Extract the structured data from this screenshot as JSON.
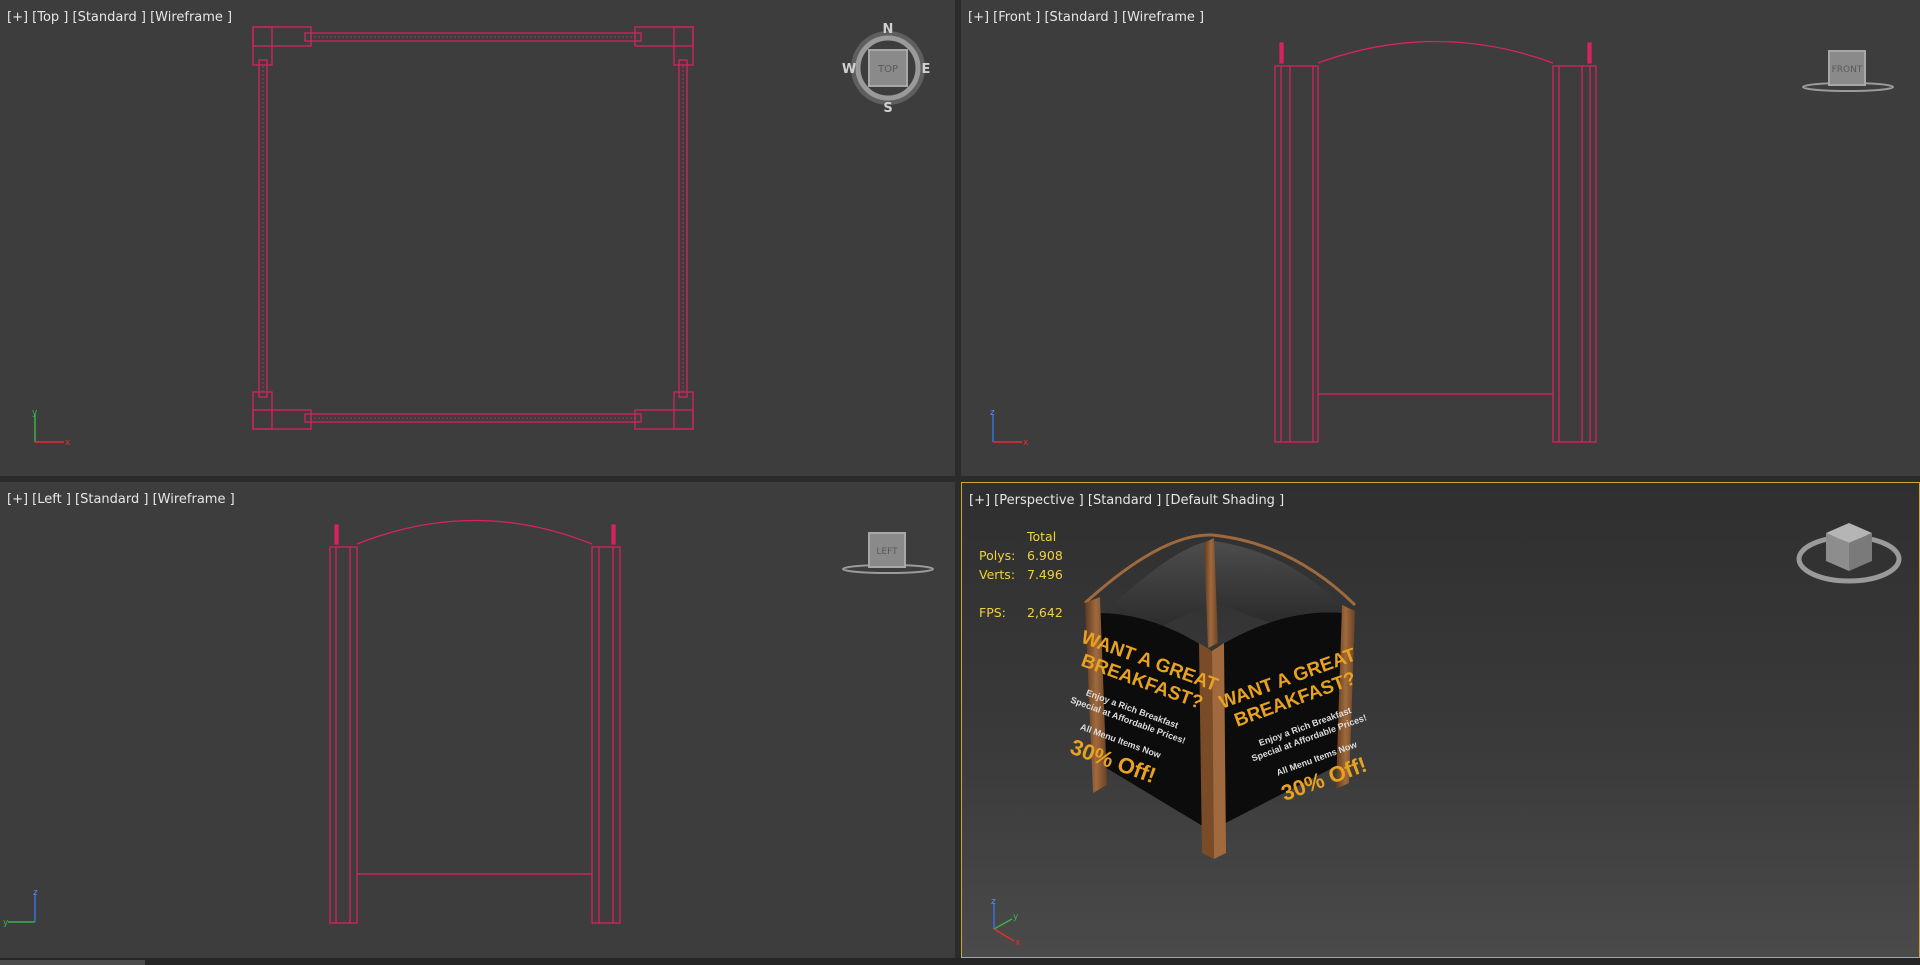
{
  "viewports": {
    "top": {
      "label": "[+] [Top ] [Standard ] [Wireframe ]",
      "cube_label": "TOP",
      "compass": {
        "n": "N",
        "s": "S",
        "e": "E",
        "w": "W"
      },
      "axes": {
        "a": "y",
        "b": "x"
      }
    },
    "front": {
      "label": "[+] [Front ] [Standard ] [Wireframe ]",
      "cube_label": "FRONT",
      "axes": {
        "a": "z",
        "b": "x"
      }
    },
    "left": {
      "label": "[+] [Left ] [Standard ] [Wireframe ]",
      "cube_label": "LEFT",
      "axes": {
        "a": "z",
        "b": "y"
      }
    },
    "perspective": {
      "label": "[+] [Perspective ] [Standard ] [Default Shading ]",
      "active": true,
      "stats": {
        "header": "Total",
        "polys_label": "Polys:",
        "polys": "6.908",
        "verts_label": "Verts:",
        "verts": "7.496",
        "fps_label": "FPS:",
        "fps": "2,642"
      },
      "sign_text": {
        "headline1": "WANT A GREAT",
        "headline2": "BREAKFAST?",
        "line1": "Enjoy a Rich Breakfast",
        "line2": "Special at Affordable Prices!",
        "line3": "All Menu Items Now",
        "discount": "30% Off!"
      },
      "axes": {
        "a": "z",
        "b": "y",
        "c": "x"
      }
    }
  },
  "colors": {
    "wireframe": "#d7245f",
    "viewport_bg": "#3d3d3d",
    "active_border": "#c9a73a",
    "stats_text": "#f0d23c",
    "wood": "#8a5a35"
  }
}
